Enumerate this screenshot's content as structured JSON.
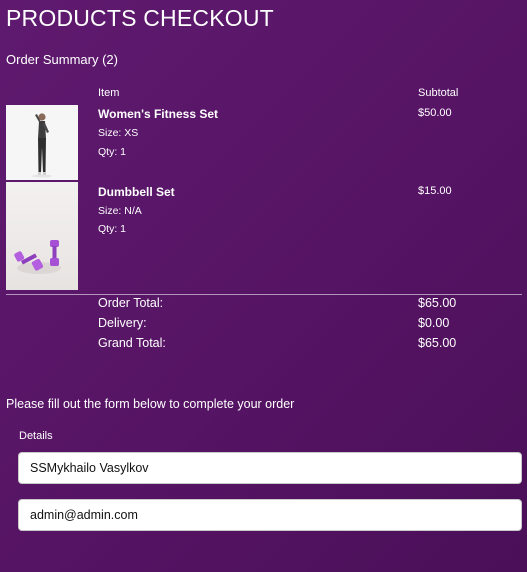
{
  "page": {
    "title": "PRODUCTS CHECKOUT"
  },
  "order_summary": {
    "heading": "Order Summary (2)",
    "columns": {
      "item": "Item",
      "subtotal": "Subtotal"
    },
    "items": [
      {
        "name": "Women's Fitness Set",
        "size": "Size: XS",
        "qty": "Qty: 1",
        "subtotal": "$50.00",
        "image_icon": "fitness-set-photo"
      },
      {
        "name": "Dumbbell Set",
        "size": "Size: N/A",
        "qty": "Qty: 1",
        "subtotal": "$15.00",
        "image_icon": "dumbbell-photo"
      }
    ],
    "totals": {
      "order_total_label": "Order Total:",
      "order_total": "$65.00",
      "delivery_label": "Delivery:",
      "delivery": "$0.00",
      "grand_total_label": "Grand Total:",
      "grand_total": "$65.00"
    }
  },
  "form": {
    "intro": "Please fill out the form below to complete your order",
    "details_label": "Details",
    "name_value": "SSMykhailo Vasylkov",
    "email_value": "admin@admin.com"
  },
  "colors": {
    "background": "#5a1768",
    "text": "#ffffff",
    "dumbbell": "#a64fd4"
  }
}
